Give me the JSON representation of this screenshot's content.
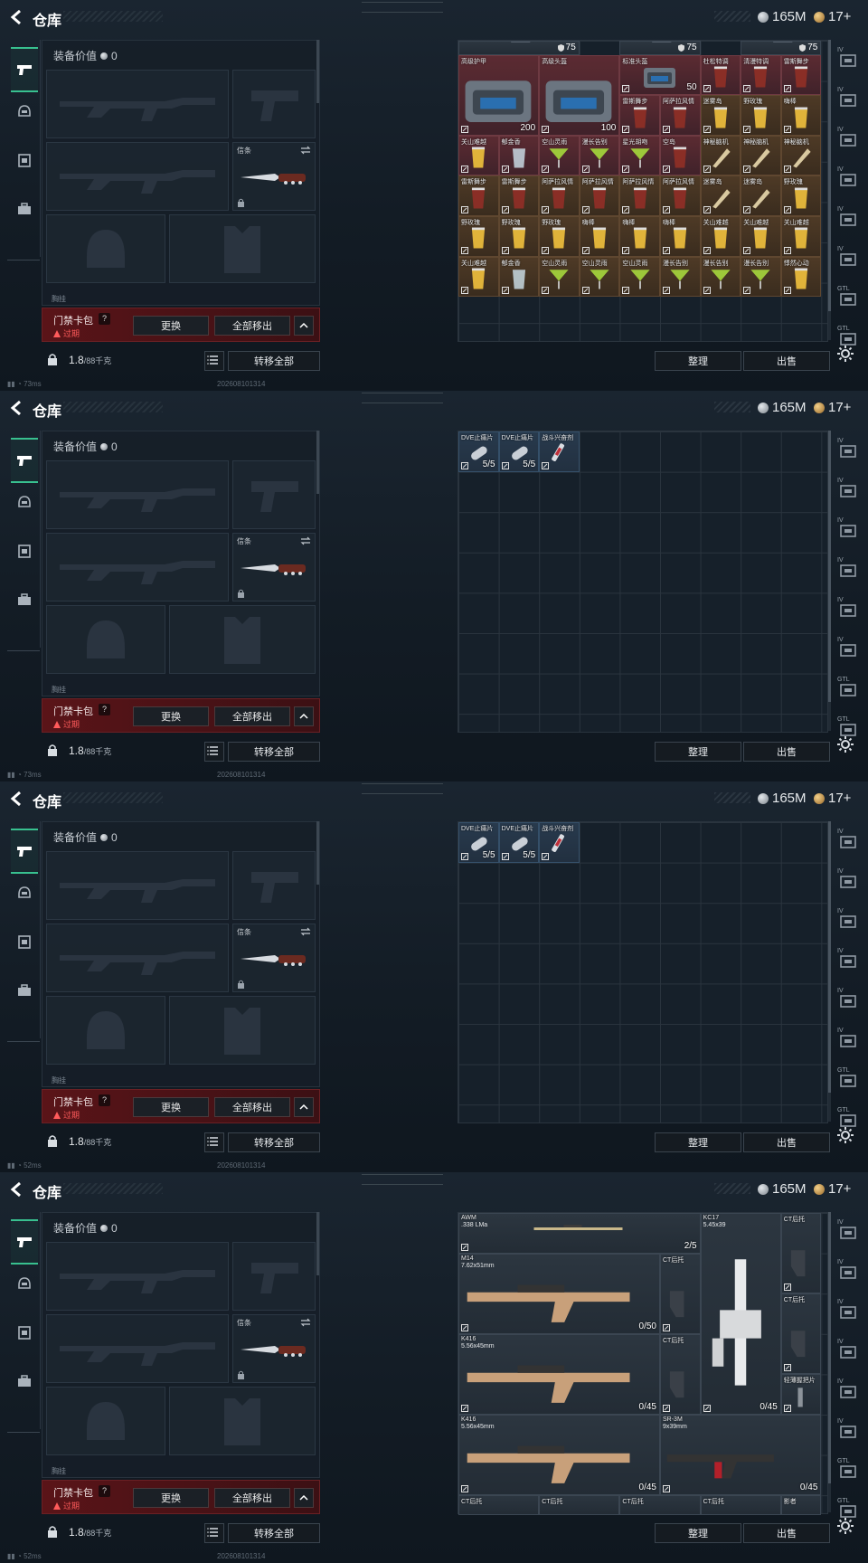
{
  "colors": {
    "accent_green": "#38c08f",
    "keycard_red": "#5a1418",
    "expired_red": "#ff5b5b",
    "item_red": "#5b2b32",
    "item_orange": "#4e3a26"
  },
  "header": {
    "title": "仓库",
    "silver": "165M",
    "gold": "17+"
  },
  "equip": {
    "label": "装备价值",
    "value": "0",
    "melee_label": "信条",
    "cut_label": "胸挂"
  },
  "keycard": {
    "name": "门禁卡包",
    "help": "?",
    "expired": "过期",
    "replace": "更换",
    "move_all": "全部移出"
  },
  "footer": {
    "weight": "1.8",
    "capacity": "/88千克",
    "transfer_all": "转移全部"
  },
  "actions": {
    "sort": "整理",
    "sell": "出售"
  },
  "right_tabs": [
    "IV",
    "IV",
    "IV",
    "IV",
    "IV",
    "IV",
    "GTL",
    "GTL"
  ],
  "screens": [
    {
      "status": "73ms",
      "timestamp": "202608101314",
      "items": [
        {
          "name": "",
          "top_val": "75",
          "c": 0,
          "r": 0,
          "w": 3,
          "h": 0.35,
          "cls": "gray",
          "icon": "helmet-strip"
        },
        {
          "name": "",
          "top_val": "75",
          "c": 4,
          "r": 0,
          "w": 2,
          "h": 0.35,
          "cls": "gray",
          "icon": "helmet-strip"
        },
        {
          "name": "",
          "top_val": "75",
          "c": 7,
          "r": 0,
          "w": 2,
          "h": 0.35,
          "cls": "gray",
          "icon": "helmet-strip"
        },
        {
          "name": "高级护甲",
          "val": "200",
          "c": 0,
          "r": 0.35,
          "w": 2,
          "h": 2,
          "cls": "red",
          "icon": "armor"
        },
        {
          "name": "高级头盔",
          "val": "100",
          "c": 2,
          "r": 0.35,
          "w": 2,
          "h": 2,
          "cls": "red",
          "icon": "armor"
        },
        {
          "name": "标准头盔",
          "val": "50",
          "c": 4,
          "r": 0.35,
          "w": 2,
          "h": 1,
          "cls": "red",
          "icon": "armor"
        },
        {
          "name": "杜松特调",
          "c": 6,
          "r": 0.35,
          "cls": "red",
          "icon": "drink-red"
        },
        {
          "name": "清漫特调",
          "c": 7,
          "r": 0.35,
          "cls": "red",
          "icon": "drink-red"
        },
        {
          "name": "雷斯舞步",
          "c": 8,
          "r": 0.35,
          "cls": "red",
          "icon": "drink-red"
        },
        {
          "name": "雷斯舞步",
          "c": 4,
          "r": 1.35,
          "cls": "red",
          "icon": "drink-red"
        },
        {
          "name": "阿萨拉风情",
          "c": 5,
          "r": 1.35,
          "cls": "red",
          "icon": "drink-red"
        },
        {
          "name": "迷雾岛",
          "c": 6,
          "r": 1.35,
          "cls": "orange",
          "icon": "drink-gold"
        },
        {
          "name": "野玫瑰",
          "c": 7,
          "r": 1.35,
          "cls": "orange",
          "icon": "drink-gold"
        },
        {
          "name": "嗨棒",
          "c": 8,
          "r": 1.35,
          "cls": "orange",
          "icon": "drink-gold"
        },
        {
          "name": "关山难越",
          "c": 0,
          "r": 2.35,
          "cls": "red",
          "icon": "drink-gold"
        },
        {
          "name": "郁金香",
          "c": 1,
          "r": 2.35,
          "cls": "red",
          "icon": "drink-clear"
        },
        {
          "name": "空山灵雨",
          "c": 2,
          "r": 2.35,
          "cls": "red",
          "icon": "drink-green"
        },
        {
          "name": "漫长告别",
          "c": 3,
          "r": 2.35,
          "cls": "red",
          "icon": "drink-green"
        },
        {
          "name": "星光胡吻",
          "c": 4,
          "r": 2.35,
          "cls": "red",
          "icon": "drink-green"
        },
        {
          "name": "空岛",
          "c": 5,
          "r": 2.35,
          "cls": "red",
          "icon": "drink-red"
        },
        {
          "name": "神秘脑机",
          "c": 6,
          "r": 2.35,
          "cls": "orange",
          "icon": "tool"
        },
        {
          "name": "神秘脑机",
          "c": 7,
          "r": 2.35,
          "cls": "orange",
          "icon": "tool"
        },
        {
          "name": "神秘脑机",
          "c": 8,
          "r": 2.35,
          "cls": "orange",
          "icon": "tool"
        },
        {
          "name": "雷斯舞步",
          "c": 0,
          "r": 3.35,
          "cls": "orange",
          "icon": "drink-red"
        },
        {
          "name": "雷斯舞步",
          "c": 1,
          "r": 3.35,
          "cls": "orange",
          "icon": "drink-red"
        },
        {
          "name": "阿萨拉风情",
          "c": 2,
          "r": 3.35,
          "cls": "orange",
          "icon": "drink-red"
        },
        {
          "name": "阿萨拉风情",
          "c": 3,
          "r": 3.35,
          "cls": "orange",
          "icon": "drink-red"
        },
        {
          "name": "阿萨拉风情",
          "c": 4,
          "r": 3.35,
          "cls": "orange",
          "icon": "drink-red"
        },
        {
          "name": "阿萨拉风情",
          "c": 5,
          "r": 3.35,
          "cls": "orange",
          "icon": "drink-red"
        },
        {
          "name": "迷雾岛",
          "c": 6,
          "r": 3.35,
          "cls": "orange",
          "icon": "tool"
        },
        {
          "name": "迷雾岛",
          "c": 7,
          "r": 3.35,
          "cls": "orange",
          "icon": "tool"
        },
        {
          "name": "野玫瑰",
          "c": 8,
          "r": 3.35,
          "cls": "orange",
          "icon": "drink-gold"
        },
        {
          "name": "野玫瑰",
          "c": 0,
          "r": 4.35,
          "cls": "orange",
          "icon": "drink-gold"
        },
        {
          "name": "野玫瑰",
          "c": 1,
          "r": 4.35,
          "cls": "orange",
          "icon": "drink-gold"
        },
        {
          "name": "野玫瑰",
          "c": 2,
          "r": 4.35,
          "cls": "orange",
          "icon": "drink-gold"
        },
        {
          "name": "嗨棒",
          "c": 3,
          "r": 4.35,
          "cls": "orange",
          "icon": "drink-gold"
        },
        {
          "name": "嗨棒",
          "c": 4,
          "r": 4.35,
          "cls": "orange",
          "icon": "drink-gold"
        },
        {
          "name": "嗨棒",
          "c": 5,
          "r": 4.35,
          "cls": "orange",
          "icon": "drink-gold"
        },
        {
          "name": "关山难越",
          "c": 6,
          "r": 4.35,
          "cls": "orange",
          "icon": "drink-gold"
        },
        {
          "name": "关山难越",
          "c": 7,
          "r": 4.35,
          "cls": "orange",
          "icon": "drink-gold"
        },
        {
          "name": "关山难越",
          "c": 8,
          "r": 4.35,
          "cls": "orange",
          "icon": "drink-gold"
        },
        {
          "name": "关山难越",
          "c": 0,
          "r": 5.35,
          "cls": "orange",
          "icon": "drink-gold"
        },
        {
          "name": "郁金香",
          "c": 1,
          "r": 5.35,
          "cls": "orange",
          "icon": "drink-clear"
        },
        {
          "name": "空山灵雨",
          "c": 2,
          "r": 5.35,
          "cls": "orange",
          "icon": "drink-green"
        },
        {
          "name": "空山灵雨",
          "c": 3,
          "r": 5.35,
          "cls": "orange",
          "icon": "drink-green"
        },
        {
          "name": "空山灵雨",
          "c": 4,
          "r": 5.35,
          "cls": "orange",
          "icon": "drink-green"
        },
        {
          "name": "漫长告别",
          "c": 5,
          "r": 5.35,
          "cls": "orange",
          "icon": "drink-green"
        },
        {
          "name": "漫长告别",
          "c": 6,
          "r": 5.35,
          "cls": "orange",
          "icon": "drink-green"
        },
        {
          "name": "漫长告别",
          "c": 7,
          "r": 5.35,
          "cls": "orange",
          "icon": "drink-green"
        },
        {
          "name": "悸然心动",
          "c": 8,
          "r": 5.35,
          "cls": "orange",
          "icon": "drink-gold"
        }
      ]
    },
    {
      "status": "73ms",
      "timestamp": "202608101314",
      "items": [
        {
          "name": "DVE止痛片",
          "val": "5/5",
          "c": 0,
          "r": 0,
          "cls": "blue",
          "icon": "pill"
        },
        {
          "name": "DVE止痛片",
          "val": "5/5",
          "c": 1,
          "r": 0,
          "cls": "blue",
          "icon": "pill"
        },
        {
          "name": "战斗兴奋剂",
          "c": 2,
          "r": 0,
          "cls": "blue",
          "icon": "syringe"
        }
      ]
    },
    {
      "status": "52ms",
      "timestamp": "202608101314",
      "items": [
        {
          "name": "DVE止痛片",
          "val": "5/5",
          "c": 0,
          "r": 0,
          "cls": "blue",
          "icon": "pill"
        },
        {
          "name": "DVE止痛片",
          "val": "5/5",
          "c": 1,
          "r": 0,
          "cls": "blue",
          "icon": "pill"
        },
        {
          "name": "战斗兴奋剂",
          "c": 2,
          "r": 0,
          "cls": "blue",
          "icon": "syringe"
        }
      ]
    },
    {
      "status": "52ms",
      "timestamp": "202608101314",
      "items": [
        {
          "name": "AWM",
          "sub": ".338 LMa",
          "val": "2/5",
          "c": 0,
          "r": 0,
          "w": 6,
          "h": 1,
          "cls": "gray",
          "icon": "rifle-long"
        },
        {
          "name": "KC17",
          "sub": "5.45x39",
          "val": "0/45",
          "c": 6,
          "r": 0,
          "w": 2,
          "h": 5,
          "cls": "gray",
          "icon": "rifle-vert"
        },
        {
          "name": "CT后托",
          "c": 8,
          "r": 0,
          "w": 1,
          "h": 2,
          "cls": "gray",
          "icon": "stock"
        },
        {
          "name": "M14",
          "sub": "7.62x51mm",
          "val": "0/50",
          "c": 0,
          "r": 1,
          "w": 5,
          "h": 2,
          "cls": "gray",
          "icon": "rifle"
        },
        {
          "name": "CT后托",
          "c": 5,
          "r": 1,
          "w": 1,
          "h": 2,
          "cls": "gray",
          "icon": "stock"
        },
        {
          "name": "CT后托",
          "c": 8,
          "r": 2,
          "w": 1,
          "h": 2,
          "cls": "gray",
          "icon": "stock"
        },
        {
          "name": "K416",
          "sub": "5.56x45mm",
          "val": "0/45",
          "c": 0,
          "r": 3,
          "w": 5,
          "h": 2,
          "cls": "gray",
          "icon": "rifle"
        },
        {
          "name": "CT后托",
          "c": 5,
          "r": 3,
          "w": 1,
          "h": 2,
          "cls": "gray",
          "icon": "stock"
        },
        {
          "name": "轻薄握把片",
          "c": 8,
          "r": 4,
          "w": 1,
          "h": 1,
          "cls": "gray",
          "icon": "grip"
        },
        {
          "name": "K416",
          "sub": "5.56x45mm",
          "val": "0/45",
          "c": 0,
          "r": 5,
          "w": 5,
          "h": 2,
          "cls": "gray",
          "icon": "rifle"
        },
        {
          "name": "SR-3M",
          "sub": "9x39mm",
          "val": "0/45",
          "c": 5,
          "r": 5,
          "w": 4,
          "h": 2,
          "cls": "gray",
          "icon": "rifle-red"
        },
        {
          "name": "CT后托",
          "c": 0,
          "r": 7,
          "w": 2,
          "h": 0.5,
          "cls": "gray",
          "icon": "none"
        },
        {
          "name": "CT后托",
          "c": 2,
          "r": 7,
          "w": 2,
          "h": 0.5,
          "cls": "gray",
          "icon": "none"
        },
        {
          "name": "CT后托",
          "c": 4,
          "r": 7,
          "w": 2,
          "h": 0.5,
          "cls": "gray",
          "icon": "none"
        },
        {
          "name": "CT后托",
          "c": 6,
          "r": 7,
          "w": 2,
          "h": 0.5,
          "cls": "gray",
          "icon": "none"
        },
        {
          "name": "影者",
          "c": 8,
          "r": 7,
          "w": 1,
          "h": 0.5,
          "cls": "gray",
          "icon": "none"
        }
      ]
    }
  ]
}
